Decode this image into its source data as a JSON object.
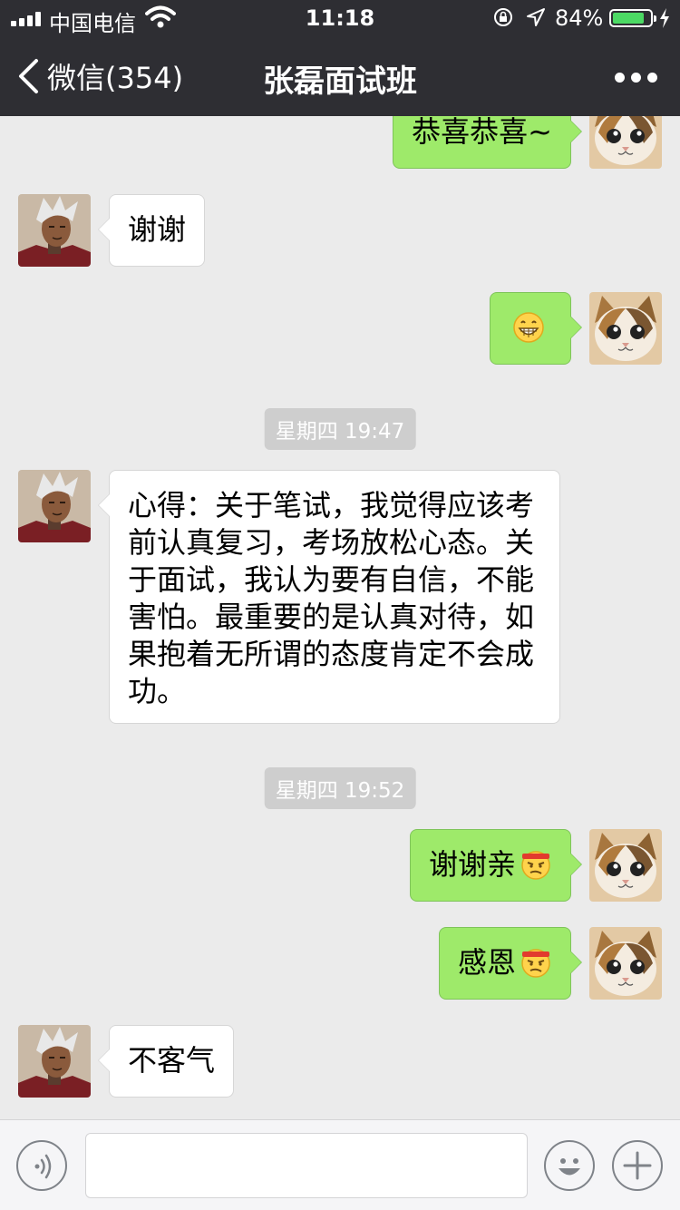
{
  "status_bar": {
    "carrier": "中国电信",
    "time": "11:18",
    "battery_percent": "84%",
    "battery_level": 0.84
  },
  "nav": {
    "back_label": "微信(354)",
    "title": "张磊面试班"
  },
  "messages": [
    {
      "side": "out",
      "text": "恭喜恭喜~",
      "emoji": ""
    },
    {
      "side": "in",
      "text": "谢谢",
      "emoji": ""
    },
    {
      "side": "out",
      "text": "",
      "emoji": "grinning-emoji"
    },
    {
      "side": "in",
      "text": "心得：关于笔试，我觉得应该考前认真复习，考场放松心态。关于面试，我认为要有自信，不能害怕。最重要的是认真对待，如果抱着无所谓的态度肯定不会成功。",
      "emoji": ""
    },
    {
      "side": "out",
      "text": "谢谢亲",
      "emoji": "headband-smirk-emoji"
    },
    {
      "side": "out",
      "text": "感恩",
      "emoji": "headband-smirk-emoji"
    },
    {
      "side": "in",
      "text": "不客气",
      "emoji": ""
    }
  ],
  "timestamps": [
    "星期四 19:47",
    "星期四 19:52"
  ],
  "input": {
    "value": "",
    "placeholder": ""
  },
  "colors": {
    "nav_bg": "#2e2e33",
    "chat_bg": "#ebebeb",
    "out_bubble": "#9eea6a",
    "in_bubble": "#ffffff",
    "battery": "#4cd964"
  }
}
